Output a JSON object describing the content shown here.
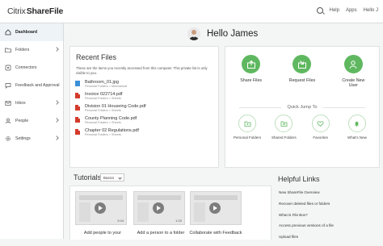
{
  "app": {
    "brand_citrix": "Citrix",
    "brand_sharefile": "ShareFile"
  },
  "topbar": {
    "help": "Help",
    "apps": "Apps",
    "user": "Hello J"
  },
  "sidebar": {
    "items": [
      {
        "label": "Dashboard",
        "icon": "home-icon"
      },
      {
        "label": "Folders",
        "icon": "folder-icon"
      },
      {
        "label": "Connectors",
        "icon": "connector-icon"
      },
      {
        "label": "Feedback and Approval",
        "icon": "feedback-icon"
      },
      {
        "label": "Inbox",
        "icon": "inbox-icon"
      },
      {
        "label": "People",
        "icon": "people-icon"
      },
      {
        "label": "Settings",
        "icon": "gear-icon"
      }
    ]
  },
  "greeting": "Hello James",
  "recent": {
    "title": "Recent Files",
    "description": "These are the items you recently accessed from this computer. This private list is only visible to you.",
    "files": [
      {
        "name": "Bathroom_01.jpg",
        "path": "Personal Folders > Mechanical",
        "type": "img"
      },
      {
        "name": "Invoice 022714.pdf",
        "path": "Personal Folders > Sheets",
        "type": "pdf"
      },
      {
        "name": "Division 01 Houseing Code.pdf",
        "path": "Personal Folders > Sheets",
        "type": "pdf"
      },
      {
        "name": "County Planning Code.pdf",
        "path": "Personal Folders > Sheets",
        "type": "pdf"
      },
      {
        "name": "Chapter 02 Regulations.pdf",
        "path": "Personal Folders > Sheets",
        "type": "pdf"
      }
    ]
  },
  "actions": {
    "share": "Share Files",
    "request": "Request Files",
    "new_user": "Create New User",
    "quick_jump": "Quick Jump To",
    "personal": "Personal Folders",
    "shared": "Shared Folders",
    "favorites": "Favorites",
    "whats_new": "What's New"
  },
  "tutorials": {
    "title": "Tutorials",
    "filter": "Basics",
    "items": [
      {
        "caption": "Add people to your",
        "duration": "2:04"
      },
      {
        "caption": "Add a person to a folder",
        "duration": "1:20"
      },
      {
        "caption": "Collaborate with Feedback",
        "duration": ""
      }
    ]
  },
  "help": {
    "title": "Helpful Links",
    "links": [
      "New ShareFile Overview",
      "Recover deleted files or folders",
      "What is File Box?",
      "Access previous versions of a file",
      "Upload files"
    ]
  },
  "colors": {
    "accent_green": "#5fb860",
    "pdf_red": "#d33b2b",
    "image_blue": "#3b8fd6"
  }
}
